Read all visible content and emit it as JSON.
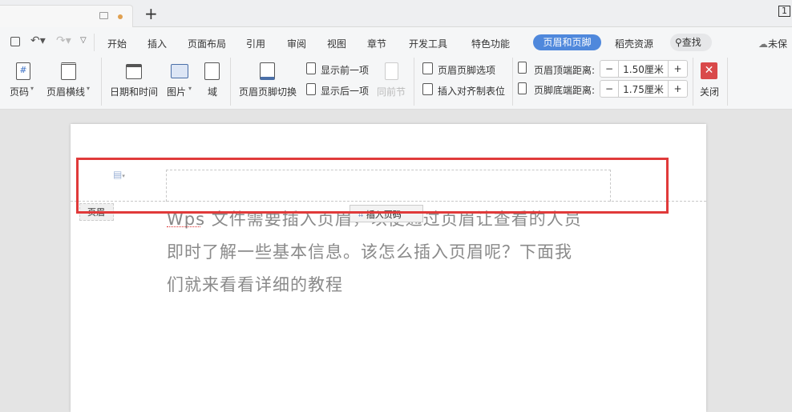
{
  "tabbar": {
    "new_tab": "+",
    "page_indicator": "1"
  },
  "menu": [
    "开始",
    "插入",
    "页面布局",
    "引用",
    "审阅",
    "视图",
    "章节",
    "开发工具",
    "特色功能",
    "页眉和页脚",
    "稻壳资源"
  ],
  "find_label": "查找",
  "unsaved_label": "未保",
  "ribbon": {
    "page_number": "页码",
    "header_line": "页眉横线",
    "date_time": "日期和时间",
    "picture": "图片",
    "field": "域",
    "switch": "页眉页脚切换",
    "show_prev": "显示前一项",
    "show_next": "显示后一项",
    "same_as_prev": "同前节",
    "options": "页眉页脚选项",
    "insert_tab": "插入对齐制表位",
    "header_top_label": "页眉顶端距离:",
    "header_top_value": "1.50厘米",
    "footer_bottom_label": "页脚底端距离:",
    "footer_bottom_value": "1.75厘米",
    "minus": "−",
    "plus": "+",
    "close": "关闭"
  },
  "document": {
    "header_tag": "页眉",
    "insert_page_number": "插入页码",
    "lines": [
      "Wps 文件需要插入页眉，以便通过页眉让查看的人员",
      "即时了解一些基本信息。该怎么插入页眉呢？下面我",
      "们就来看看详细的教程"
    ]
  },
  "colors": {
    "accent": "#4f88dc",
    "highlight": "#e03a3a",
    "close": "#d9494a"
  }
}
